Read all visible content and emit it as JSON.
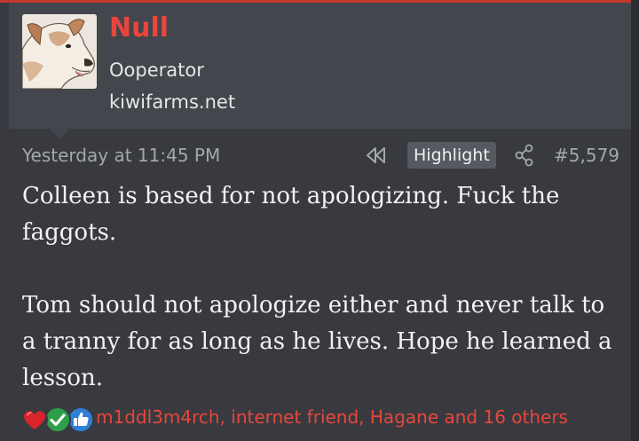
{
  "post": {
    "user": {
      "name": "Null",
      "title": "Ooperator",
      "site": "kiwifarms.net",
      "avatar_icon": "dog-avatar-icon"
    },
    "meta": {
      "timestamp": "Yesterday at 11:45 PM",
      "back_icon": "rewind-icon",
      "highlight_label": "Highlight",
      "share_icon": "share-icon",
      "post_number": "#5,579"
    },
    "message": {
      "paragraphs": [
        "Colleen is based for not apologizing. Fuck the faggots.",
        "Tom should not apologize either and never talk to a tranny for as long as he lives. Hope he learned a lesson."
      ]
    },
    "reactions": {
      "icons": [
        "heart-reaction-icon",
        "check-reaction-icon",
        "like-reaction-icon"
      ],
      "summary": "m1ddl3m4rch, internet friend, Hagane and 16 others"
    }
  },
  "colors": {
    "background": "#383a3f",
    "user_block": "#43464c",
    "accent_red": "#e8463d",
    "muted_text": "#a4a7ac",
    "body_text": "#f2f2f2"
  }
}
